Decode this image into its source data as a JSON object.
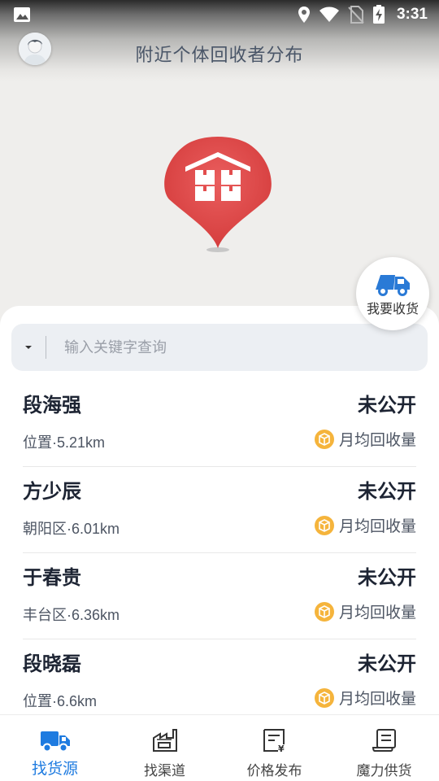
{
  "status_bar": {
    "time": "3:31",
    "icons": [
      "image-icon",
      "location-icon",
      "wifi-icon",
      "no-sim-icon",
      "battery-charging-icon"
    ]
  },
  "header": {
    "title": "附近个体回收者分布",
    "avatar_icon": "user-avatar-icon"
  },
  "map": {
    "pin_icon": "warehouse-pin-icon",
    "pin_color": "#e24d4d"
  },
  "receive_button": {
    "label": "我要收货",
    "icon": "truck-icon",
    "icon_color": "#2a7ad6"
  },
  "search": {
    "placeholder": "输入关键字查询",
    "value": ""
  },
  "collectors": [
    {
      "name": "段海强",
      "location": "位置·5.21km",
      "status": "未公开",
      "volume_label": "月均回收量"
    },
    {
      "name": "方少辰",
      "location": "朝阳区·6.01km",
      "status": "未公开",
      "volume_label": "月均回收量"
    },
    {
      "name": "于春贵",
      "location": "丰台区·6.36km",
      "status": "未公开",
      "volume_label": "月均回收量"
    },
    {
      "name": "段晓磊",
      "location": "位置·6.6km",
      "status": "未公开",
      "volume_label": "月均回收量"
    }
  ],
  "tabs": [
    {
      "label": "找货源",
      "icon": "truck-icon",
      "active": true
    },
    {
      "label": "找渠道",
      "icon": "factory-icon",
      "active": false
    },
    {
      "label": "价格发布",
      "icon": "price-doc-icon",
      "active": false
    },
    {
      "label": "魔力供货",
      "icon": "scroll-doc-icon",
      "active": false
    }
  ],
  "colors": {
    "accent": "#1e7be0",
    "volume_icon": "#f5b43c",
    "text_dark": "#1d2433"
  }
}
